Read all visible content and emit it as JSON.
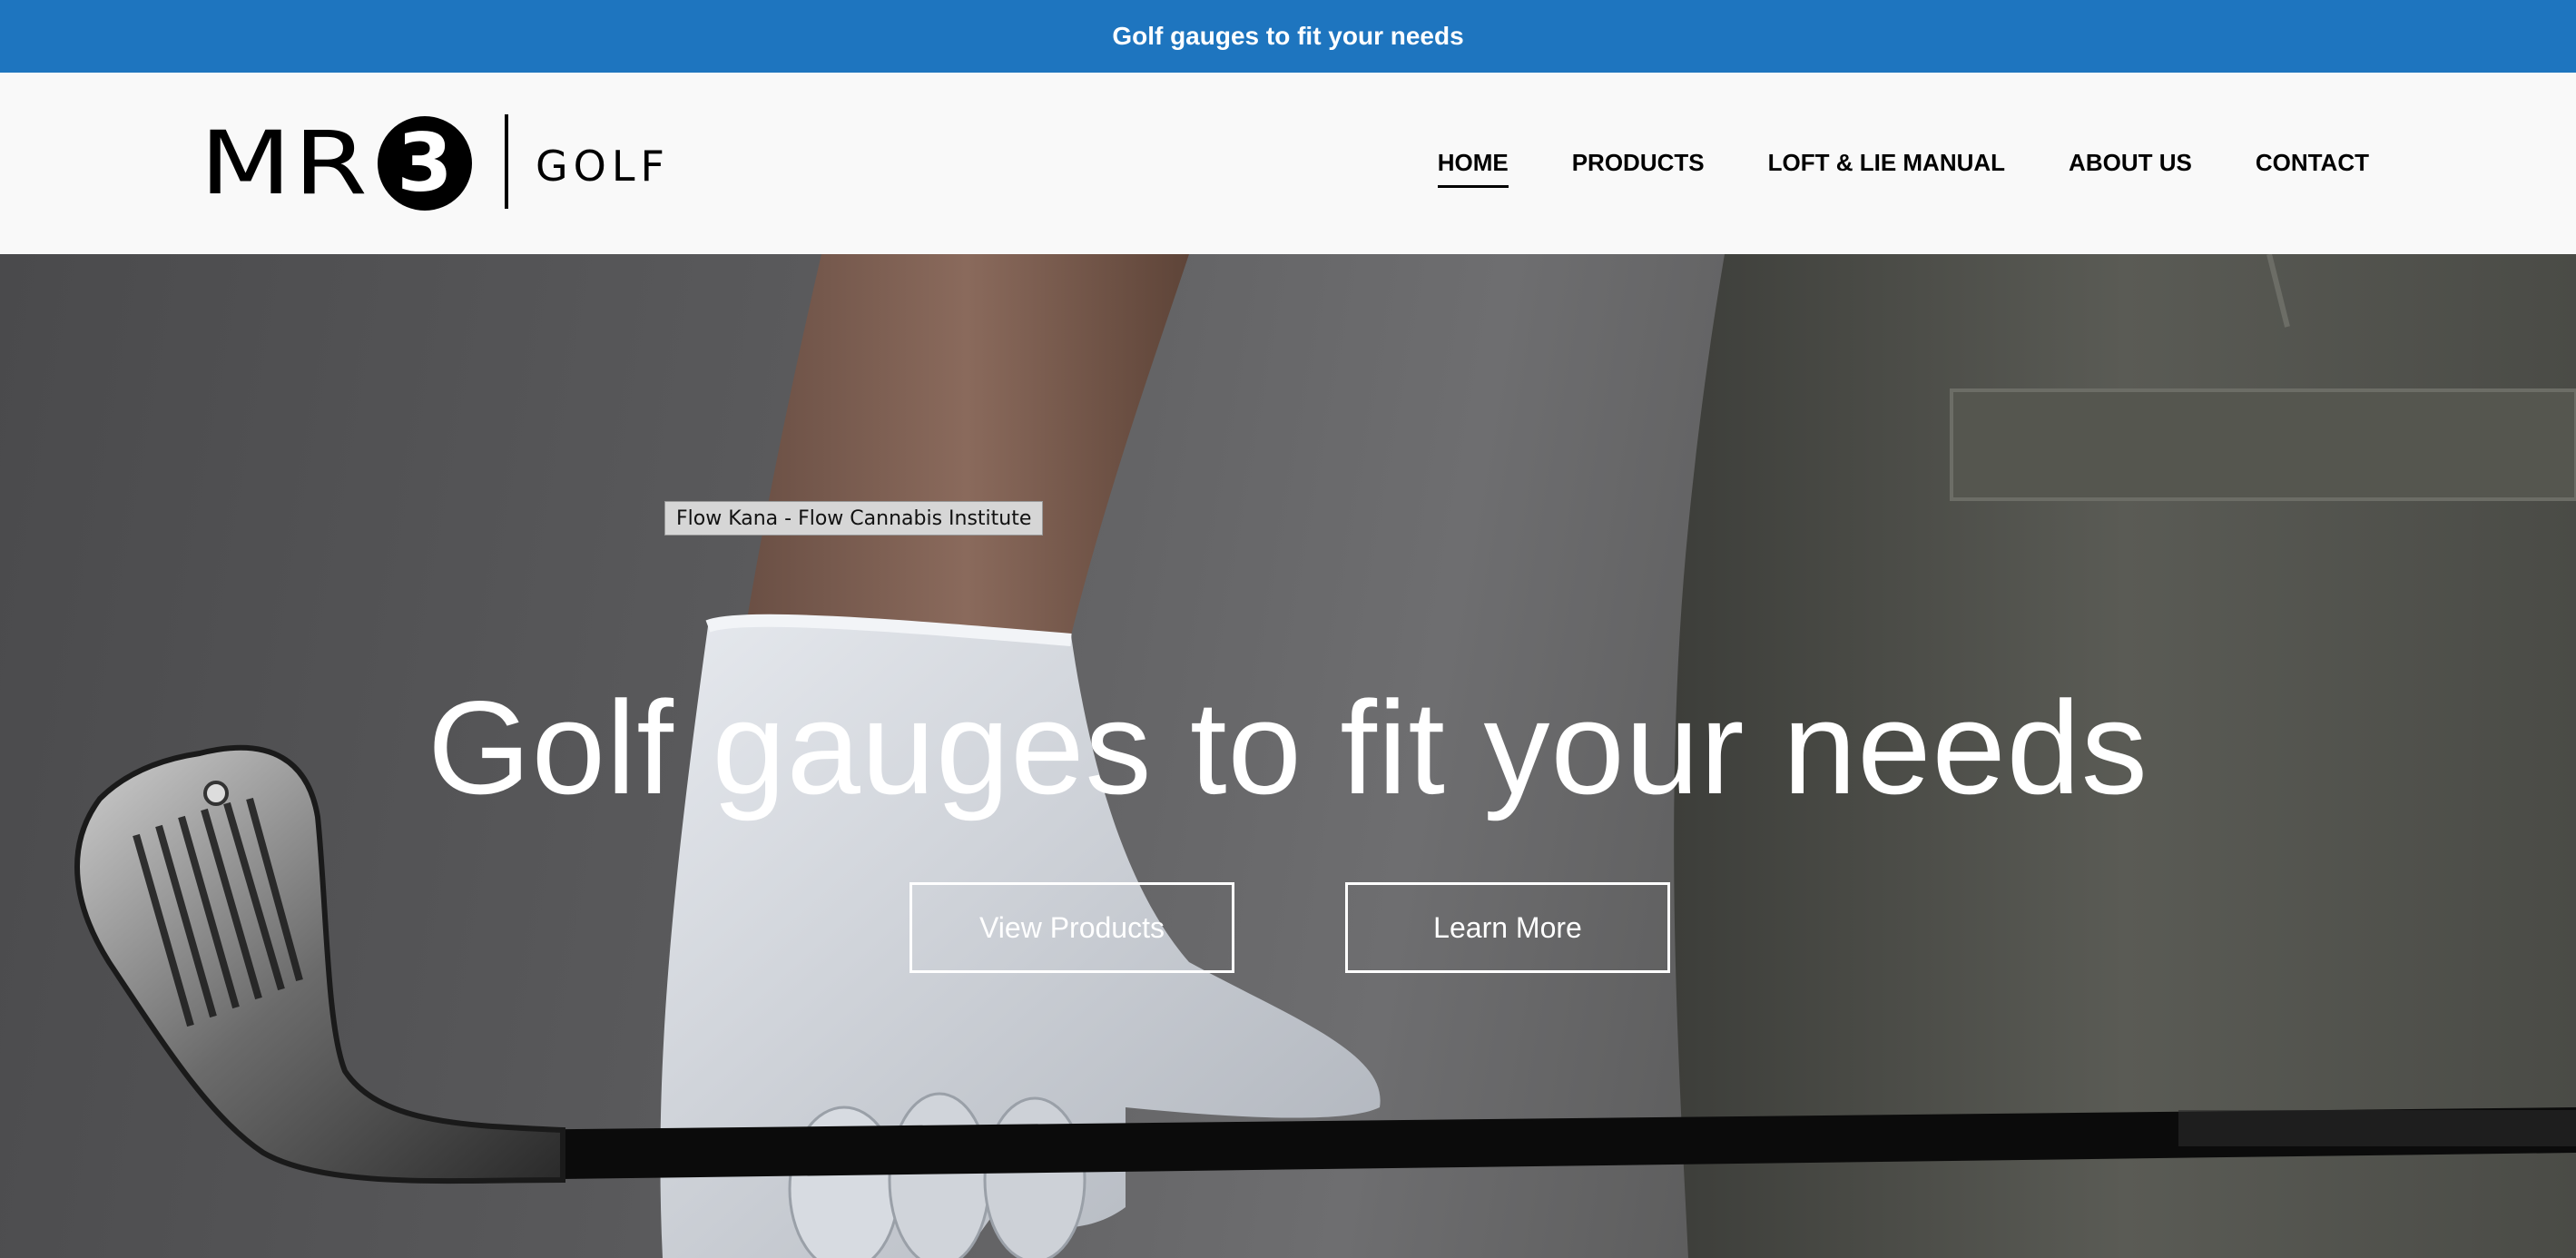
{
  "announcement": {
    "text": "Golf gauges to fit your needs"
  },
  "header": {
    "logo": {
      "mr": "MR",
      "three": "3",
      "golf": "GOLF"
    },
    "nav": [
      {
        "label": "HOME",
        "active": true
      },
      {
        "label": "PRODUCTS",
        "active": false
      },
      {
        "label": "LOFT & LIE MANUAL",
        "active": false
      },
      {
        "label": "ABOUT US",
        "active": false
      },
      {
        "label": "CONTACT",
        "active": false
      }
    ]
  },
  "hero": {
    "tooltip": "Flow Kana - Flow Cannabis Institute",
    "title": "Golf gauges to fit your needs",
    "buttons": {
      "view_products": "View Products",
      "learn_more": "Learn More"
    }
  },
  "colors": {
    "announcement_bg": "#1e75bf",
    "header_bg": "#f9f9f9",
    "text_dark": "#000000"
  }
}
